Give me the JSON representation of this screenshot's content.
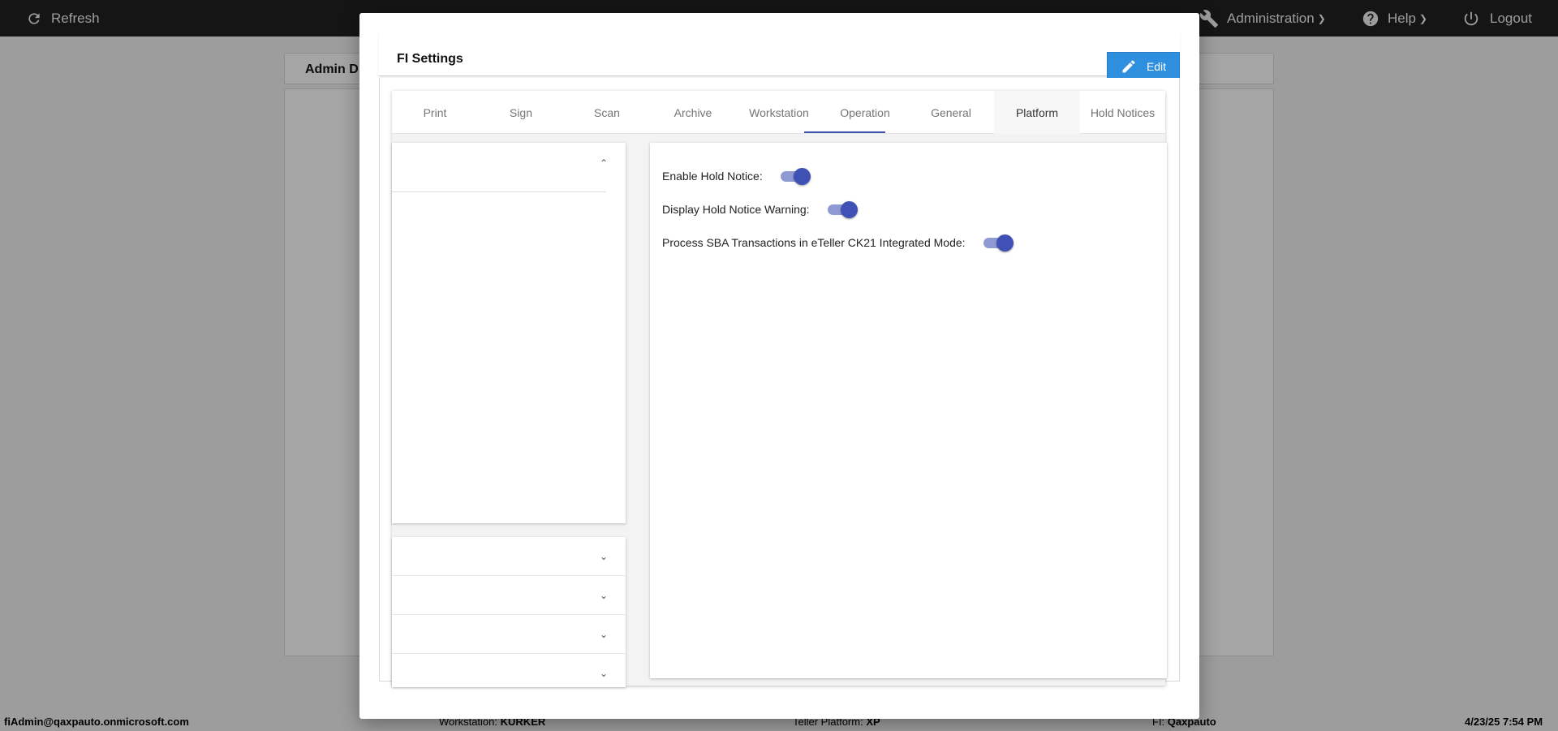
{
  "topbar": {
    "refresh_label": "Refresh",
    "administration_label": "Administration",
    "help_label": "Help",
    "logout_label": "Logout"
  },
  "background": {
    "admin_title": "Admin D"
  },
  "footer": {
    "user": "fiAdmin@qaxpauto.onmicrosoft.com",
    "workstation_label": "Workstation:",
    "workstation_value": "KURKER",
    "platform_label": "Teller Platform:",
    "platform_value": "XP",
    "fi_label": "FI:",
    "fi_value": "Qaxpauto",
    "datetime": "4/23/25 7:54 PM"
  },
  "modal": {
    "title": "FI Settings",
    "edit_label": "Edit",
    "tabs": [
      {
        "label": "Print"
      },
      {
        "label": "Sign"
      },
      {
        "label": "Scan"
      },
      {
        "label": "Archive"
      },
      {
        "label": "Workstation"
      },
      {
        "label": "Operation"
      },
      {
        "label": "General"
      },
      {
        "label": "Platform"
      },
      {
        "label": "Hold Notices"
      }
    ],
    "active_tab": "Operation",
    "settings": [
      {
        "label": "Enable Hold Notice:",
        "enabled": true
      },
      {
        "label": "Display Hold Notice Warning:",
        "enabled": true
      },
      {
        "label": "Process SBA Transactions in eTeller CK21 Integrated Mode:",
        "enabled": true
      }
    ]
  },
  "colors": {
    "accent": "#3f51b5",
    "edit_button": "#2f8fdf",
    "topbar": "#1f1f1f"
  }
}
